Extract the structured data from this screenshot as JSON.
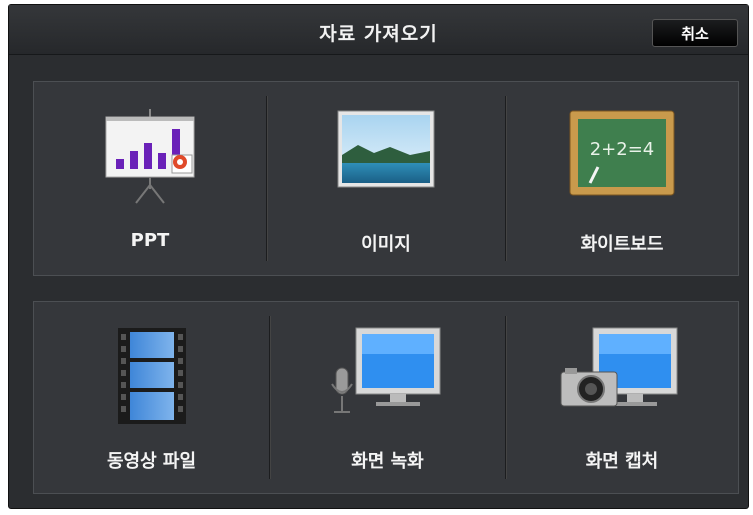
{
  "dialog": {
    "title": "자료 가져오기",
    "cancel_label": "취소"
  },
  "tiles_row1": [
    {
      "label": "PPT",
      "icon": "ppt-chart-icon"
    },
    {
      "label": "이미지",
      "icon": "image-icon"
    },
    {
      "label": "화이트보드",
      "icon": "whiteboard-icon"
    }
  ],
  "tiles_row2": [
    {
      "label": "동영상 파일",
      "icon": "film-strip-icon"
    },
    {
      "label": "화면 녹화",
      "icon": "monitor-microphone-icon"
    },
    {
      "label": "화면 캡처",
      "icon": "monitor-camera-icon"
    }
  ],
  "whiteboard_text": "2+2=4",
  "colors": {
    "dialog_bg": "#2b2d30",
    "panel_bg": "#35373b",
    "text": "#f4f4f4"
  }
}
